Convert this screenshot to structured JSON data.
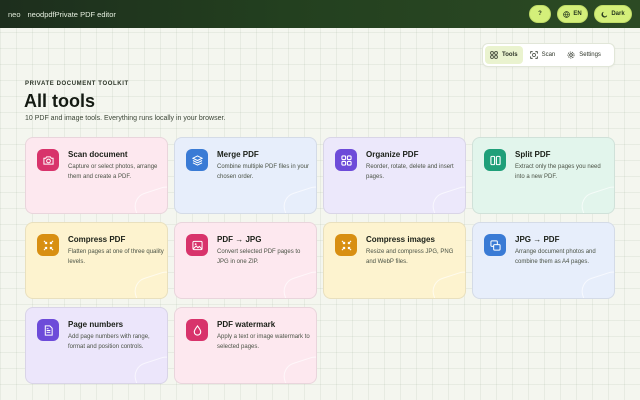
{
  "header": {
    "logo": "neo",
    "app_name": "neodpdf",
    "subtitle": "Private PDF editor",
    "help_label": "?",
    "lang_label": "EN",
    "theme_label": "Dark"
  },
  "nav": {
    "items": [
      {
        "label": "Tools",
        "icon": "grid-icon",
        "active": true
      },
      {
        "label": "Scan",
        "icon": "scan-icon",
        "active": false
      },
      {
        "label": "Settings",
        "icon": "gear-icon",
        "active": false
      }
    ]
  },
  "page": {
    "eyebrow": "PRIVATE DOCUMENT TOOLKIT",
    "title": "All tools",
    "lede": "10 PDF and image tools. Everything runs locally in your browser."
  },
  "tools": [
    {
      "title": "Scan document",
      "desc": "Capture or select photos, arrange them and create a PDF.",
      "icon": "camera-icon",
      "icon_color": "#d8336b",
      "bg": "#fde8ef"
    },
    {
      "title": "Merge PDF",
      "desc": "Combine multiple PDF files in your chosen order.",
      "icon": "layers-icon",
      "icon_color": "#3a7bd5",
      "bg": "#e7eefb"
    },
    {
      "title": "Organize PDF",
      "desc": "Reorder, rotate, delete and insert pages.",
      "icon": "grid-icon",
      "icon_color": "#6d4bd9",
      "bg": "#ece8fb"
    },
    {
      "title": "Split PDF",
      "desc": "Extract only the pages you need into a new PDF.",
      "icon": "split-icon",
      "icon_color": "#1f9f79",
      "bg": "#e2f5ec"
    },
    {
      "title": "Compress PDF",
      "desc": "Flatten pages at one of three quality levels.",
      "icon": "compress-icon",
      "icon_color": "#d88f12",
      "bg": "#fdf3cf"
    },
    {
      "title": "PDF → JPG",
      "desc": "Convert selected PDF pages to JPG in one ZIP.",
      "icon": "image-icon",
      "icon_color": "#d8336b",
      "bg": "#fde8ef"
    },
    {
      "title": "Compress images",
      "desc": "Resize and compress JPG, PNG and WebP files.",
      "icon": "compress-icon",
      "icon_color": "#d88f12",
      "bg": "#fdf3cf"
    },
    {
      "title": "JPG → PDF",
      "desc": "Arrange document photos and combine them as A4 pages.",
      "icon": "images-icon",
      "icon_color": "#3a7bd5",
      "bg": "#e7eefb"
    },
    {
      "title": "Page numbers",
      "desc": "Add page numbers with range, format and position controls.",
      "icon": "page-number-icon",
      "icon_color": "#6d4bd9",
      "bg": "#ece6fb"
    },
    {
      "title": "PDF watermark",
      "desc": "Apply a text or image watermark to selected pages.",
      "icon": "droplet-icon",
      "icon_color": "#d8336b",
      "bg": "#fde8ef"
    }
  ]
}
